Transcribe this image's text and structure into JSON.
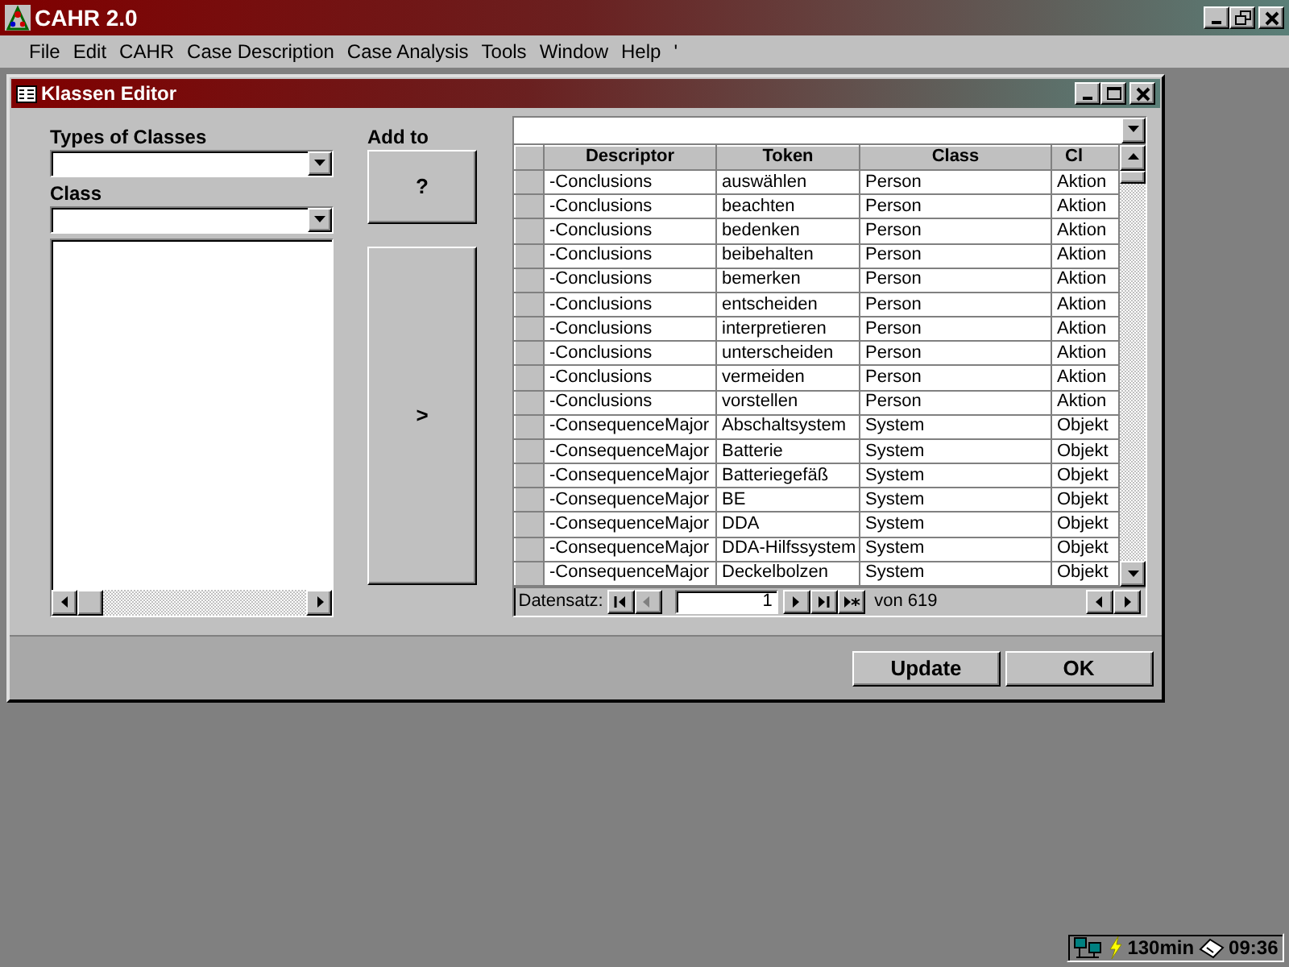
{
  "app": {
    "title": "CAHR 2.0"
  },
  "menu": [
    "File",
    "Edit",
    "CAHR",
    "Case Description",
    "Case Analysis",
    "Tools",
    "Window",
    "Help",
    "'"
  ],
  "window": {
    "title": "Klassen Editor"
  },
  "types_label": "Types of Classes",
  "class_label": "Class",
  "add_to_label": "Add to",
  "side_buttons": [
    "?",
    ">"
  ],
  "grid": {
    "columns": [
      "Descriptor",
      "Token",
      "Class",
      "Cl"
    ],
    "rows": [
      [
        "-Conclusions",
        "auswählen",
        "Person",
        "Aktion"
      ],
      [
        "-Conclusions",
        "beachten",
        "Person",
        "Aktion"
      ],
      [
        "-Conclusions",
        "bedenken",
        "Person",
        "Aktion"
      ],
      [
        "-Conclusions",
        "beibehalten",
        "Person",
        "Aktion"
      ],
      [
        "-Conclusions",
        "bemerken",
        "Person",
        "Aktion"
      ],
      [
        "-Conclusions",
        "entscheiden",
        "Person",
        "Aktion"
      ],
      [
        "-Conclusions",
        "interpretieren",
        "Person",
        "Aktion"
      ],
      [
        "-Conclusions",
        "unterscheiden",
        "Person",
        "Aktion"
      ],
      [
        "-Conclusions",
        "vermeiden",
        "Person",
        "Aktion"
      ],
      [
        "-Conclusions",
        "vorstellen",
        "Person",
        "Aktion"
      ],
      [
        "-ConsequenceMajor",
        "Abschaltsystem",
        "System",
        "Objekt"
      ],
      [
        "-ConsequenceMajor",
        "Batterie",
        "System",
        "Objekt"
      ],
      [
        "-ConsequenceMajor",
        "Batteriegefäß",
        "System",
        "Objekt"
      ],
      [
        "-ConsequenceMajor",
        "BE",
        "System",
        "Objekt"
      ],
      [
        "-ConsequenceMajor",
        "DDA",
        "System",
        "Objekt"
      ],
      [
        "-ConsequenceMajor",
        "DDA-Hilfssystem",
        "System",
        "Objekt"
      ],
      [
        "-ConsequenceMajor",
        "Deckelbolzen",
        "System",
        "Objekt"
      ]
    ]
  },
  "navigator": {
    "label": "Datensatz:",
    "record": "1",
    "total": "von 619"
  },
  "buttons": [
    "Update",
    "OK"
  ],
  "tray": {
    "battery": "130min",
    "clock": "09:36"
  }
}
